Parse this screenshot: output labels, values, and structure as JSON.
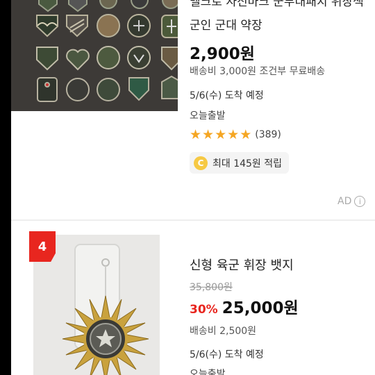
{
  "colors": {
    "accent_red": "#e8261f",
    "star": "#f5a623",
    "coin": "#f6c944",
    "thumb1_bg": "#3d3a37",
    "thumb2_bg": "#e9e8e6"
  },
  "product1": {
    "title": "벨크로 자진마크 군부대패치 위장색 군인 군대 약장",
    "price": "2,900원",
    "shipping": "배송비 3,000원 조건부 무료배송",
    "delivery": "5/6(수) 도착 예정",
    "today": "오늘출발",
    "rating": {
      "stars": 5,
      "reviews": "(389)"
    },
    "points": {
      "coin": "C",
      "text": "최대 145원 적립"
    },
    "ad": {
      "label": "AD",
      "info_icon": "i"
    },
    "thumbnail_icon": "military-patches-image"
  },
  "product2": {
    "rank": "4",
    "title": "신형 육군 휘장 뱃지",
    "original_price": "35,800원",
    "discount": "30%",
    "price": "25,000원",
    "shipping": "배송비 2,500원",
    "delivery": "5/6(수) 도착 예정",
    "today": "오늘출발",
    "thumbnail_icon": "army-badge-image"
  }
}
